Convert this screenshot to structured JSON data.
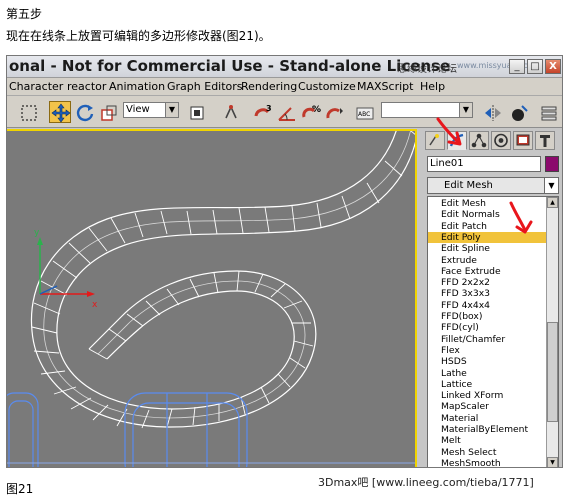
{
  "caption": {
    "step": "第五步",
    "description": "现在在线条上放置可编辑的多边形修改器(图21)。",
    "figure": "图21"
  },
  "titlebar": {
    "title": "onal - Not for Commercial Use - Stand-alone License",
    "watermark": "思缘设计论坛",
    "watermark_url": "www.missyuan.com",
    "minimize": "_",
    "maximize": "□",
    "close": "X"
  },
  "menu": {
    "items": [
      "Character",
      "reactor",
      "Animation",
      "Graph Editors",
      "Rendering",
      "Customize",
      "MAXScript",
      "Help"
    ]
  },
  "toolbar": {
    "view_label": "View",
    "icons": [
      "select-region-icon",
      "move-icon",
      "rotate-icon",
      "scale-icon",
      "pivot-icon",
      "snap-3d-icon",
      "angle-snap-icon",
      "percent-snap-icon",
      "spinner-snap-icon",
      "named-selection-icon",
      "mirror-icon",
      "align-icon",
      "material-editor-icon",
      "layers-icon"
    ]
  },
  "command_panel": {
    "tabs": [
      "create-icon",
      "modify-icon",
      "hierarchy-icon",
      "motion-icon",
      "display-icon",
      "utilities-icon"
    ],
    "active_tab": "modify-icon",
    "object_name": "Line01",
    "object_color": "#8b0a6c",
    "modifier_dropdown": "Edit Mesh",
    "modifier_list": [
      "Edit Mesh",
      "Edit Normals",
      "Edit Patch",
      "Edit Poly",
      "Edit Spline",
      "Extrude",
      "Face Extrude",
      "FFD 2x2x2",
      "FFD 3x3x3",
      "FFD 4x4x4",
      "FFD(box)",
      "FFD(cyl)",
      "Fillet/Chamfer",
      "Flex",
      "HSDS",
      "Lathe",
      "Lattice",
      "Linked XForm",
      "MapScaler",
      "Material",
      "MaterialByElement",
      "Melt",
      "Mesh Select",
      "MeshSmooth"
    ],
    "selected_modifier": "Edit Poly"
  },
  "viewport": {
    "axis_y": "y",
    "axis_x": "x",
    "background": "#7a7a7a",
    "active_border": "#f0d400"
  },
  "footer_watermark": "3Dmax吧  [www.lineeg.com/tieba/1771]",
  "colors": {
    "highlight": "#f1c33b",
    "annotation_red": "#e8161c"
  }
}
